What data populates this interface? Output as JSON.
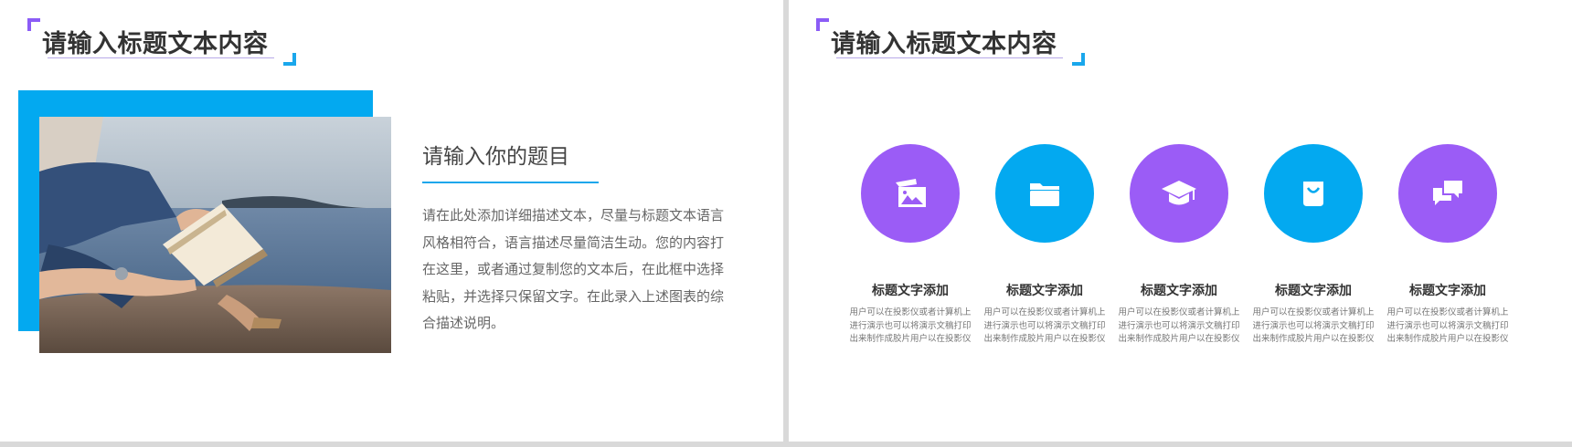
{
  "colors": {
    "purple": "#9b5cf6",
    "blue": "#03a9f0",
    "title_text": "#333333",
    "body_text": "#666666"
  },
  "left_slide": {
    "title": "请输入标题文本内容",
    "subtitle": "请输入你的题目",
    "description": "请在此处添加详细描述文本，尽量与标题文本语言风格相符合，语言描述尽量简洁生动。您的内容打在这里，或者通过复制您的文本后，在此框中选择粘贴，并选择只保留文字。在此录入上述图表的综合描述说明。"
  },
  "right_slide": {
    "title": "请输入标题文本内容",
    "items": [
      {
        "icon": "image-icon",
        "color": "purple",
        "title": "标题文字添加",
        "text": "用户可以在投影仪或者计算机上进行演示也可以将演示文稿打印出来制作成胶片用户以在投影仪"
      },
      {
        "icon": "folder-icon",
        "color": "blue",
        "title": "标题文字添加",
        "text": "用户可以在投影仪或者计算机上进行演示也可以将演示文稿打印出来制作成胶片用户以在投影仪"
      },
      {
        "icon": "graduation-cap-icon",
        "color": "purple",
        "title": "标题文字添加",
        "text": "用户可以在投影仪或者计算机上进行演示也可以将演示文稿打印出来制作成胶片用户以在投影仪"
      },
      {
        "icon": "shopping-bag-icon",
        "color": "blue",
        "title": "标题文字添加",
        "text": "用户可以在投影仪或者计算机上进行演示也可以将演示文稿打印出来制作成胶片用户以在投影仪"
      },
      {
        "icon": "chat-bubbles-icon",
        "color": "purple",
        "title": "标题文字添加",
        "text": "用户可以在投影仪或者计算机上进行演示也可以将演示文稿打印出来制作成胶片用户以在投影仪"
      }
    ]
  }
}
